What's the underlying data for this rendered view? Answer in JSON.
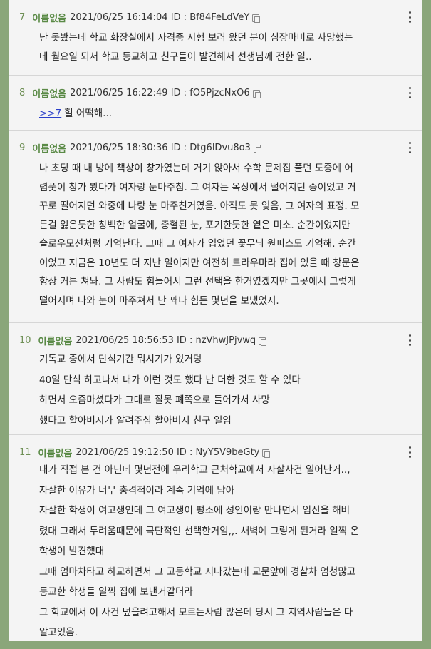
{
  "posts": [
    {
      "number": "7",
      "name": "이름없음",
      "meta": "2021/06/25 16:14:04 ID : Bf84FeLdVeY",
      "lines": [
        "난 못봤는데 학교 화장실에서 자격증 시험 보러 왔던 분이 심장마비로 사망했는",
        "데 월요일 되서 학교 등교하고 친구들이 발견해서 선생님께 전한 일.."
      ]
    },
    {
      "number": "8",
      "name": "이름없음",
      "meta": "2021/06/25 16:22:49 ID : fO5PjzcNxO6",
      "anchor": ">>7",
      "lines": [
        "헐 어떡해..."
      ]
    },
    {
      "number": "9",
      "name": "이름없음",
      "meta": "2021/06/25 18:30:36 ID : Dtg6lDvu8o3",
      "lines": [
        "나 초딩 때 내 방에 책상이 창가였는데 거기 앉아서 수학 문제집 풀던 도중에 어",
        "렴풋이 창가 봤다가 여자랑 눈마주침. 그 여자는 옥상에서 떨어지던 중이었고 거",
        "꾸로 떨어지던 와중에 나랑 눈 마주친거였음. 아직도 못 잊음, 그 여자의 표정. 모",
        "든걸 잃은듯한 창백한 얼굴에, 충혈된 눈, 포기한듯한 옅은 미소. 순간이었지만",
        "슬로우모션처럼 기억난다. 그때 그 여자가 입었던 꽃무늬 원피스도 기억해. 순간",
        "이었고 지금은 10년도 더 지난 일이지만 여전히 트라우마라 집에 있을 때 창문은",
        "항상 커튼 쳐놔. 그 사람도 힘들어서 그런 선택을 한거였겠지만 그곳에서 그렇게",
        "떨어지며 나와 눈이 마주쳐서 난 꽤나 힘든 몇년을 보냈었지."
      ]
    },
    {
      "number": "10",
      "name": "이름없음",
      "meta": "2021/06/25 18:56:53 ID : nzVhwJPjvwq",
      "lines": [
        "기독교 중에서 단식기간 뭐시기가 있거덩",
        "40일 단식 하고나서 내가 이런 것도 했다 난 더한 것도 할 수 있다",
        "하면서 오즘마셨다가 그대로 잘못 폐쪽으로 들어가서 사망",
        "했다고 할아버지가 알려주심 할아버지 친구 일임"
      ]
    },
    {
      "number": "11",
      "name": "이름없음",
      "meta": "2021/06/25 19:12:50 ID : NyY5V9beGty",
      "lines": [
        "내가 직접 본 건 아닌데 몇년전에 우리학교 근처학교에서 자살사건 일어난거..,",
        "자살한 이유가 너무 충격적이라 계속 기억에 남아",
        "자살한 학생이 여고생인데 그 여고생이 평소에 성인이랑 만나면서 임신을 해버",
        "렸대 그래서 두려움때문에 극단적인 선택한거임,,. 새벽에 그렇게 된거라 일찍 온",
        "학생이 발견했대",
        "그때 엄마차타고 하교하면서 그 고등학교 지나갔는데 교문앞에 경찰차 엄청많고",
        "등교한 학생들 일찍 집에 보낸거같더라",
        "그 학교에서 이 사건 덮을려고해서 모르는사람 많은데 당시 그 지역사람들은 다",
        "알고있음."
      ]
    }
  ]
}
